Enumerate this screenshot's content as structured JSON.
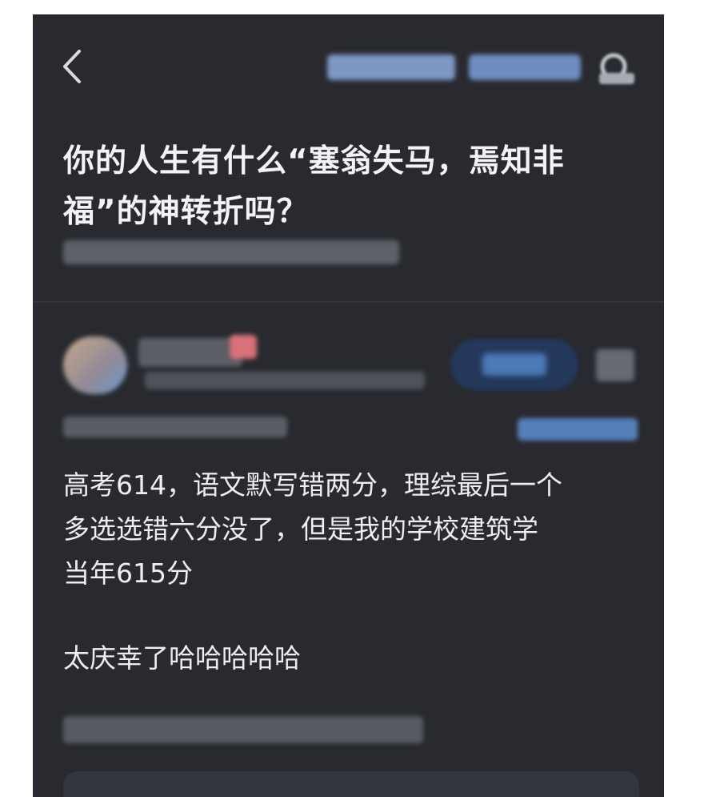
{
  "question": {
    "title_line1": "你的人生有什么“塞翁失马，焉知非",
    "title_line2": "福”的神转折吗？"
  },
  "answer": {
    "line1": "高考614，语文默写错两分，理综最后一个",
    "line2": "多选选错六分没了，但是我的学校建筑学",
    "line3": "当年615分",
    "line4": "太庆幸了哈哈哈哈哈"
  },
  "icons": {
    "back": "chevron-left-icon",
    "search": "search-icon",
    "share": "share-icon"
  },
  "colors": {
    "background": "#282a30",
    "text": "#eceef1",
    "accent_blue": "#3a6fb8"
  }
}
